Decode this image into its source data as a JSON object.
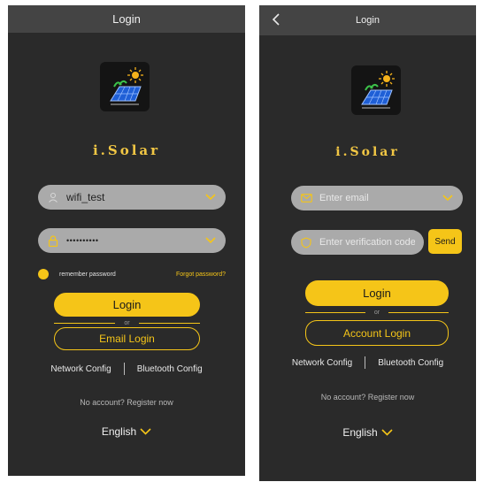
{
  "login_screen": {
    "title": "Login",
    "brand": "i.Solar",
    "username": {
      "value": "wifi_test"
    },
    "password": {
      "value": "••••••••••"
    },
    "remember_label": "remember password",
    "forgot_label": "Forgot password?",
    "login_button": "Login",
    "or_label": "or",
    "email_login_button": "Email Login",
    "network_config": "Network Config",
    "bluetooth_config": "Bluetooth Config",
    "register_link": "No account? Register now",
    "language": "English"
  },
  "email_screen": {
    "title": "Login",
    "brand": "i.Solar",
    "email": {
      "placeholder": "Enter email"
    },
    "code": {
      "placeholder": "Enter verification code"
    },
    "send_button": "Send",
    "login_button": "Login",
    "or_label": "or",
    "account_login_button": "Account Login",
    "network_config": "Network Config",
    "bluetooth_config": "Bluetooth Config",
    "register_link": "No account? Register now",
    "language": "English"
  },
  "icons": {
    "back": "chevron-left-icon",
    "logo": "solar-panel-sun-icon",
    "user": "user-icon",
    "lock": "lock-icon",
    "email": "envelope-icon",
    "shield": "shield-icon",
    "dropdown": "chevron-down-icon"
  },
  "colors": {
    "background": "#2a2a2a",
    "topbar": "#444444",
    "accent": "#f5c518",
    "field": "#aaaaaa",
    "brand_text": "#f2c744"
  }
}
